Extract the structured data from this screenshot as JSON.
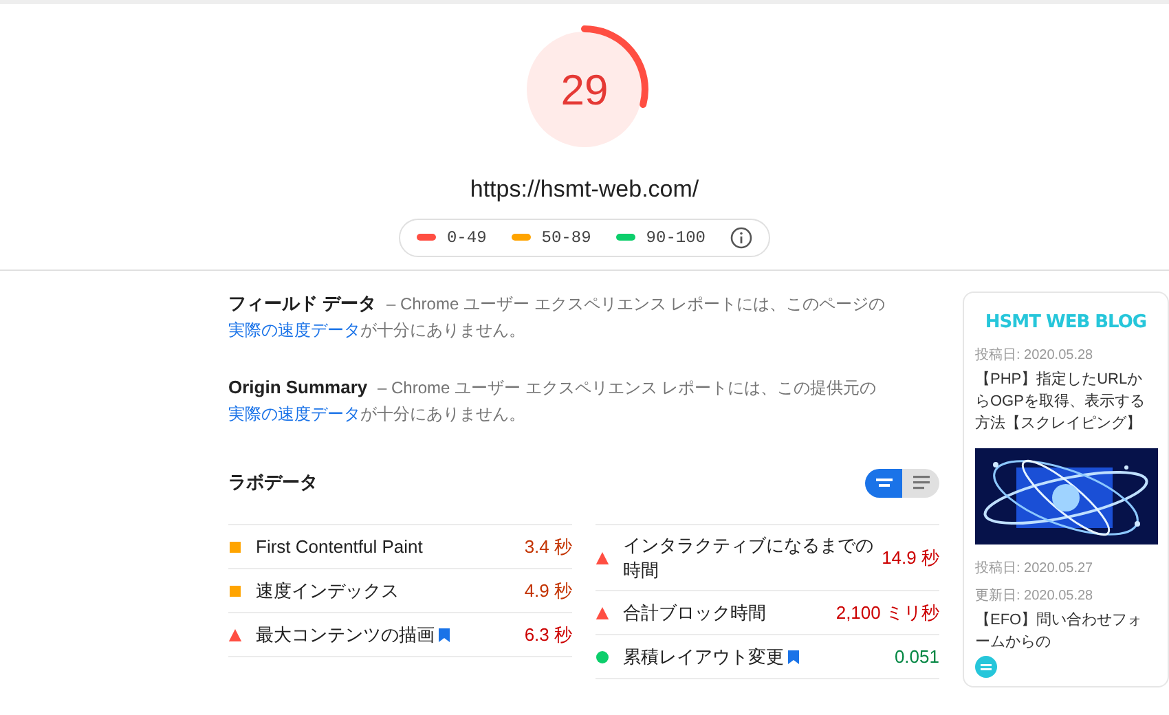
{
  "score": {
    "value": "29",
    "level": 0.29,
    "url": "https://hsmt-web.com/"
  },
  "legend": [
    {
      "label": "0-49",
      "color": "#ff4e42"
    },
    {
      "label": "50-89",
      "color": "#ffa400"
    },
    {
      "label": "90-100",
      "color": "#0cce6b"
    }
  ],
  "field_data": [
    {
      "title": "フィールド データ",
      "text": " – Chrome ユーザー エクスペリエンス レポートには、このページの",
      "link": "実際の速度データ",
      "tail": "が十分にありません。"
    },
    {
      "title": "Origin Summary",
      "text": " – Chrome ユーザー エクスペリエンス レポートには、この提供元の",
      "link": "実際の速度データ",
      "tail": "が十分にありません。"
    }
  ],
  "lab_data": {
    "title": "ラボデータ",
    "view_toggle": [
      {
        "selected": true
      },
      {
        "selected": false
      }
    ],
    "columns": [
      [
        {
          "name": "First Contentful Paint",
          "value": "3.4 秒",
          "kind": "average",
          "flagged": false
        },
        {
          "name": "速度インデックス",
          "value": "4.9 秒",
          "kind": "average",
          "flagged": false
        },
        {
          "name": "最大コンテンツの描画",
          "value": "6.3 秒",
          "kind": "fail",
          "flagged": true
        }
      ],
      [
        {
          "name": "インタラクティブになるまでの時間",
          "value": "14.9 秒",
          "kind": "fail",
          "flagged": false
        },
        {
          "name": "合計ブロック時間",
          "value": "2,100 ミリ秒",
          "kind": "fail",
          "flagged": false
        },
        {
          "name": "累積レイアウト変更",
          "value": "0.051",
          "kind": "pass",
          "flagged": true
        }
      ]
    ]
  },
  "preview": {
    "logo": "HSMT WEB BLOG",
    "posts": [
      {
        "dates": [
          "投稿日: 2020.05.28"
        ],
        "title": "【PHP】指定したURLからOGPを取得、表示する方法【スクレイピング】"
      },
      {
        "kind": "picture"
      },
      {
        "dates": [
          "投稿日: 2020.05.27",
          "更新日: 2020.05.28"
        ],
        "title": "【EFO】問い合わせフォームからの"
      }
    ]
  }
}
